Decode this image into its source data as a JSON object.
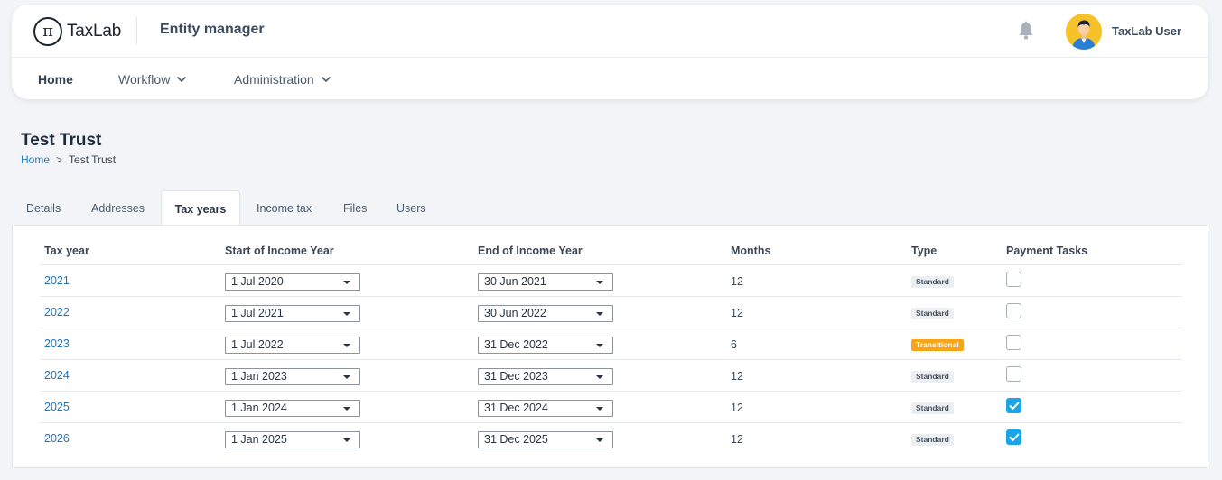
{
  "header": {
    "logo_glyph": "π",
    "logo_text": "TaxLab",
    "app_title": "Entity manager",
    "user_name": "TaxLab User",
    "bell_icon": "bell-icon",
    "avatar_color": "#f6c22a"
  },
  "nav": {
    "items": [
      {
        "label": "Home",
        "active": true,
        "has_dropdown": false
      },
      {
        "label": "Workflow",
        "active": false,
        "has_dropdown": true
      },
      {
        "label": "Administration",
        "active": false,
        "has_dropdown": true
      }
    ]
  },
  "page": {
    "title": "Test Trust",
    "breadcrumb": {
      "home": "Home",
      "separator": ">",
      "current": "Test Trust"
    }
  },
  "tabs": [
    {
      "label": "Details"
    },
    {
      "label": "Addresses"
    },
    {
      "label": "Tax years",
      "active": true
    },
    {
      "label": "Income tax"
    },
    {
      "label": "Files"
    },
    {
      "label": "Users"
    }
  ],
  "table": {
    "columns": {
      "tax_year": "Tax year",
      "start": "Start of Income Year",
      "end": "End of Income Year",
      "months": "Months",
      "type": "Type",
      "payment_tasks": "Payment Tasks"
    },
    "rows": [
      {
        "year": "2021",
        "start": "1 Jul 2020",
        "end": "30 Jun 2021",
        "months": "12",
        "type": "Standard",
        "type_kind": "standard",
        "payment_tasks": false
      },
      {
        "year": "2022",
        "start": "1 Jul 2021",
        "end": "30 Jun 2022",
        "months": "12",
        "type": "Standard",
        "type_kind": "standard",
        "payment_tasks": false
      },
      {
        "year": "2023",
        "start": "1 Jul 2022",
        "end": "31 Dec 2022",
        "months": "6",
        "type": "Transitional",
        "type_kind": "transitional",
        "payment_tasks": false
      },
      {
        "year": "2024",
        "start": "1 Jan 2023",
        "end": "31 Dec 2023",
        "months": "12",
        "type": "Standard",
        "type_kind": "standard",
        "payment_tasks": false
      },
      {
        "year": "2025",
        "start": "1 Jan 2024",
        "end": "31 Dec 2024",
        "months": "12",
        "type": "Standard",
        "type_kind": "standard",
        "payment_tasks": true
      },
      {
        "year": "2026",
        "start": "1 Jan 2025",
        "end": "31 Dec 2025",
        "months": "12",
        "type": "Standard",
        "type_kind": "standard",
        "payment_tasks": true
      }
    ]
  },
  "colors": {
    "link": "#1f73b7",
    "checkbox_checked": "#1aa5e6",
    "badge_transitional": "#f7a417",
    "badge_standard": "#eceff2"
  }
}
